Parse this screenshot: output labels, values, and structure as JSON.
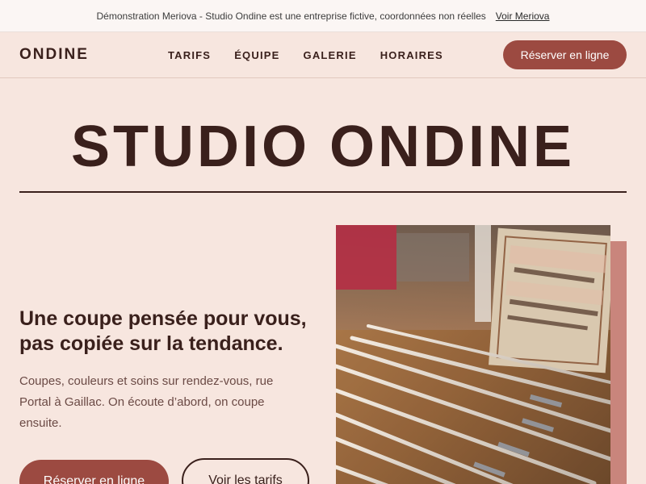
{
  "demo_bar": {
    "notice": "Démonstration Meriova - Studio Ondine est une entreprise fictive, coordonnées non réelles",
    "link_label": "Voir Meriova"
  },
  "nav": {
    "logo": "ONDINE",
    "links": [
      "TARIFS",
      "ÉQUIPE",
      "GALERIE",
      "HORAIRES"
    ],
    "cta_label": "Réserver en ligne"
  },
  "hero": {
    "title": "STUDIO ONDINE",
    "tagline": "Une coupe pensée pour vous, pas copiée sur la tendance.",
    "intro": "Coupes, couleurs et soins sur rendez-vous, rue Portal à Gaillac. On écoute d’abord, on coupe ensuite.",
    "primary_button": "Réserver en ligne",
    "secondary_button": "Voir les tarifs"
  },
  "colors": {
    "background": "#f7e6df",
    "accent": "#9c4a41",
    "text": "#3a201c",
    "photo_shadow": "#c9857c"
  }
}
